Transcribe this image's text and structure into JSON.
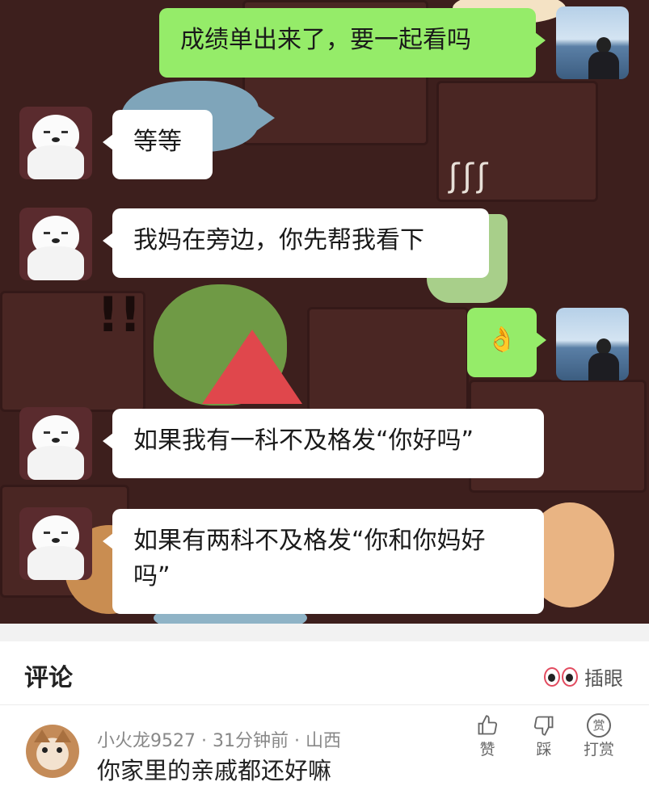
{
  "chat": {
    "messages": [
      {
        "from": "me",
        "text": "成绩单出来了，要一起看吗"
      },
      {
        "from": "friend",
        "text": "等等"
      },
      {
        "from": "friend",
        "text": "我妈在旁边，你先帮我看下"
      },
      {
        "from": "me",
        "text": "👌",
        "icon": "ok-hand-emoji"
      },
      {
        "from": "friend",
        "text": "如果我有一科不及格发“你好吗”"
      },
      {
        "from": "friend",
        "text": "如果有两科不及格发“你和你妈好吗”"
      }
    ],
    "avatars": {
      "me": "sea-view-avatar",
      "friend": "white-bear-avatar"
    },
    "bubble_colors": {
      "me": "#95ec69",
      "friend": "#ffffff"
    }
  },
  "comments": {
    "title": "评论",
    "insert_eye_label": "插眼",
    "items": [
      {
        "user": "小火龙9527",
        "time": "31分钟前",
        "location": "山西",
        "text": "你家里的亲戚都还好嘛",
        "actions": {
          "like": "赞",
          "dislike": "踩",
          "reward": "打赏",
          "reward_icon_char": "赏"
        }
      }
    ]
  }
}
